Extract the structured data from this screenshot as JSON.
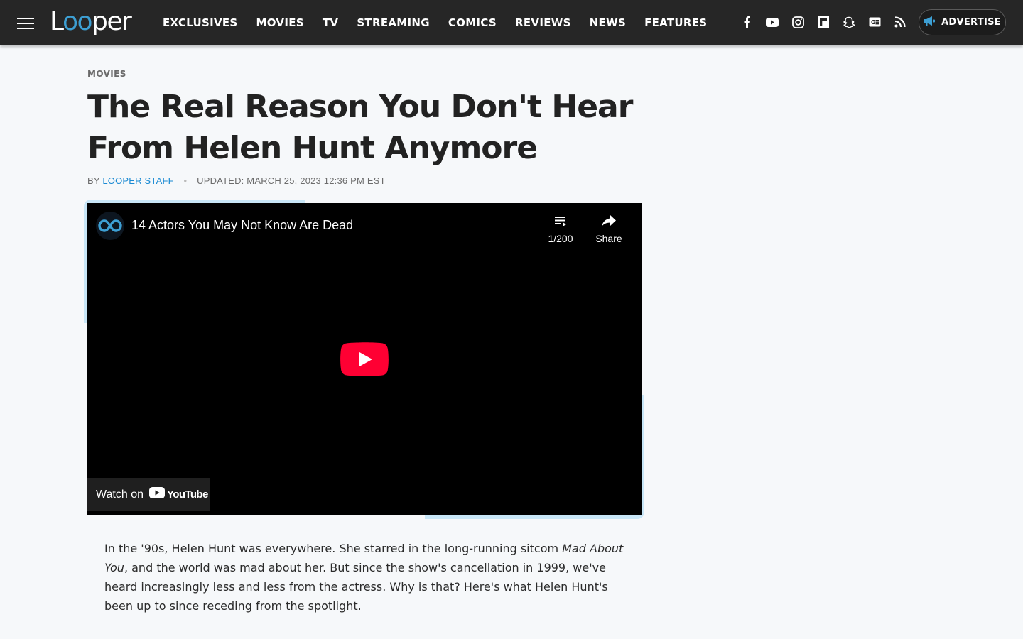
{
  "header": {
    "logo_prefix": "L",
    "logo_oo": "oo",
    "logo_suffix": "per",
    "nav": [
      "EXCLUSIVES",
      "MOVIES",
      "TV",
      "STREAMING",
      "COMICS",
      "REVIEWS",
      "NEWS",
      "FEATURES"
    ],
    "socials": [
      "facebook-icon",
      "youtube-icon",
      "instagram-icon",
      "flipboard-icon",
      "snapchat-icon",
      "google-news-icon",
      "rss-icon"
    ],
    "advertise_label": "ADVERTISE"
  },
  "article": {
    "category": "MOVIES",
    "title": "The Real Reason You Don't Hear From Helen Hunt Anymore",
    "by": "BY",
    "author": "LOOPER STAFF",
    "updated": "UPDATED: MARCH 25, 2023 12:36 PM EST"
  },
  "video": {
    "title": "14 Actors You May Not Know Are Dead",
    "playlist_count": "1/200",
    "share_label": "Share",
    "watch_on": "Watch on",
    "youtube_wordmark": "YouTube"
  },
  "body": {
    "p1_before": "In the '90s, Helen Hunt was everywhere. She starred in the long-running sitcom ",
    "p1_em": "Mad About You",
    "p1_after": ", and the world was mad about her. But since the show's cancellation in 1999, we've heard increasingly less and less from the actress. Why is that? Here's what Helen Hunt's been up to since receding from the spotlight."
  },
  "colors": {
    "header_bg": "#262626",
    "accent_blue": "#3d9fd3",
    "author_link": "#1a8ad3",
    "youtube_red": "#ff0033"
  }
}
